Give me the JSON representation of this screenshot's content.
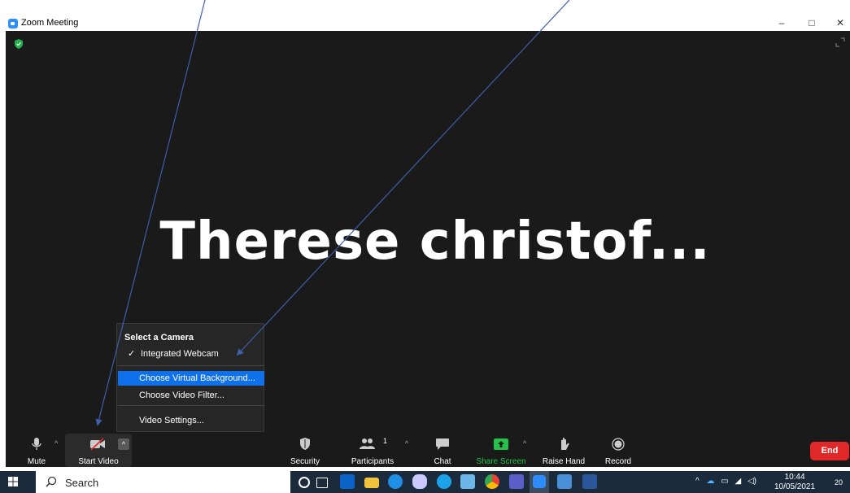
{
  "window": {
    "title": "Zoom Meeting",
    "minimize": "–",
    "maximize": "□",
    "close": "✕"
  },
  "meeting": {
    "participant_name": "Therese christof...",
    "background": "#1a1a1a"
  },
  "camera_menu": {
    "header": "Select a Camera",
    "items": [
      {
        "label": "Integrated Webcam",
        "checked": true
      },
      {
        "label": "Choose Virtual Background...",
        "highlighted": true
      },
      {
        "label": "Choose Video Filter..."
      },
      {
        "label": "Video Settings..."
      }
    ],
    "checkmark": "✓",
    "highlight_color": "#0e71eb"
  },
  "toolbar": {
    "mute": "Mute",
    "start_video": "Start Video",
    "security": "Security",
    "participants": "Participants",
    "participants_count": "1",
    "chat": "Chat",
    "share_screen": "Share Screen",
    "raise_hand": "Raise Hand",
    "record": "Record",
    "end": "End",
    "caret": "^"
  },
  "taskbar": {
    "search_placeholder": "Search",
    "time": "10:44",
    "date": "10/05/2021",
    "notification_count": "20",
    "apps": [
      "cortana-icon",
      "task-view-icon",
      "outlook-icon",
      "file-explorer-icon",
      "edge-icon",
      "paint-icon",
      "skype-icon",
      "app-icon",
      "chrome-icon",
      "teams-icon",
      "zoom-icon",
      "network-app-icon",
      "word-icon"
    ]
  },
  "colors": {
    "share_green": "#22c24b",
    "end_red": "#e02828",
    "zoom_blue": "#2d8cff",
    "annotation_arrow": "#3d5fa8"
  }
}
